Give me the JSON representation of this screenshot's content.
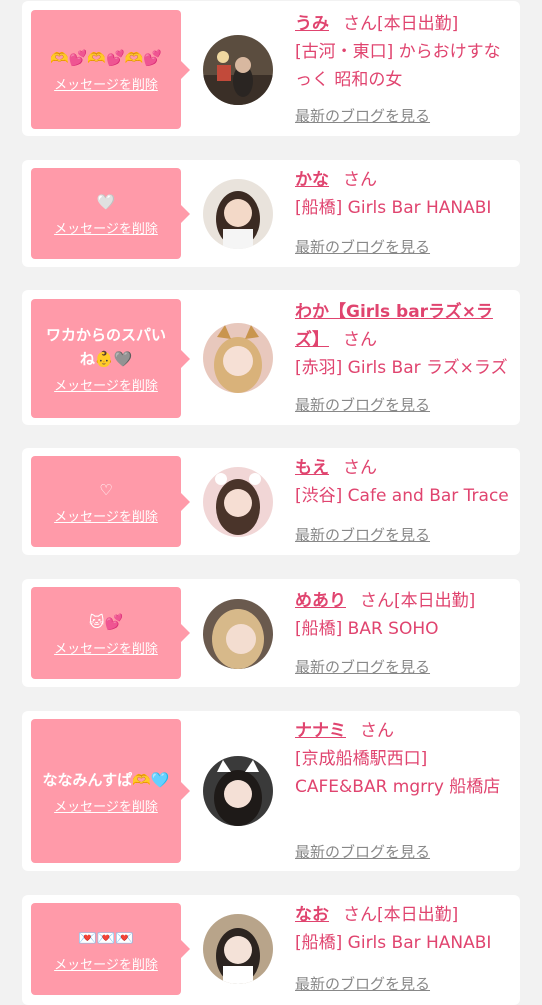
{
  "favorites": [
    {
      "message": "🫶💕🫶💕🫶💕",
      "delete_label": "メッセージを削除",
      "name": "うみ",
      "san": "さん",
      "status": "[本日出勤]",
      "shop": "[古河・東口] からおけすなっく 昭和の女",
      "blog_label": "最新のブログを見る"
    },
    {
      "message": "🤍",
      "delete_label": "メッセージを削除",
      "name": "かな",
      "san": "さん",
      "status": "",
      "shop": "[船橋] Girls Bar HANABI",
      "blog_label": "最新のブログを見る"
    },
    {
      "message": "ワカからのスパいね👶🩶",
      "delete_label": "メッセージを削除",
      "name": "わか【Girls barラズ×ラズ】",
      "san": "さん",
      "status": "",
      "shop": "[赤羽] Girls Bar ラズ×ラズ",
      "blog_label": "最新のブログを見る"
    },
    {
      "message": "♡",
      "delete_label": "メッセージを削除",
      "name": "もえ",
      "san": "さん",
      "status": "",
      "shop": "[渋谷] Cafe and Bar Trace",
      "blog_label": "最新のブログを見る"
    },
    {
      "message": "🐱💕",
      "delete_label": "メッセージを削除",
      "name": "めあり",
      "san": "さん",
      "status": "[本日出勤]",
      "shop": "[船橋] BAR SOHO",
      "blog_label": "最新のブログを見る"
    },
    {
      "message": "ななみんすぱ🫶🩵",
      "delete_label": "メッセージを削除",
      "name": "ナナミ",
      "san": "さん",
      "status": "",
      "shop": "[京成船橋駅西口] CAFE&BAR mgrry 船橋店",
      "blog_label": "最新のブログを見る"
    },
    {
      "message": "💌💌💌",
      "delete_label": "メッセージを削除",
      "name": "なお",
      "san": "さん",
      "status": "[本日出勤]",
      "shop": "[船橋] Girls Bar HANABI",
      "blog_label": "最新のブログを見る"
    }
  ]
}
